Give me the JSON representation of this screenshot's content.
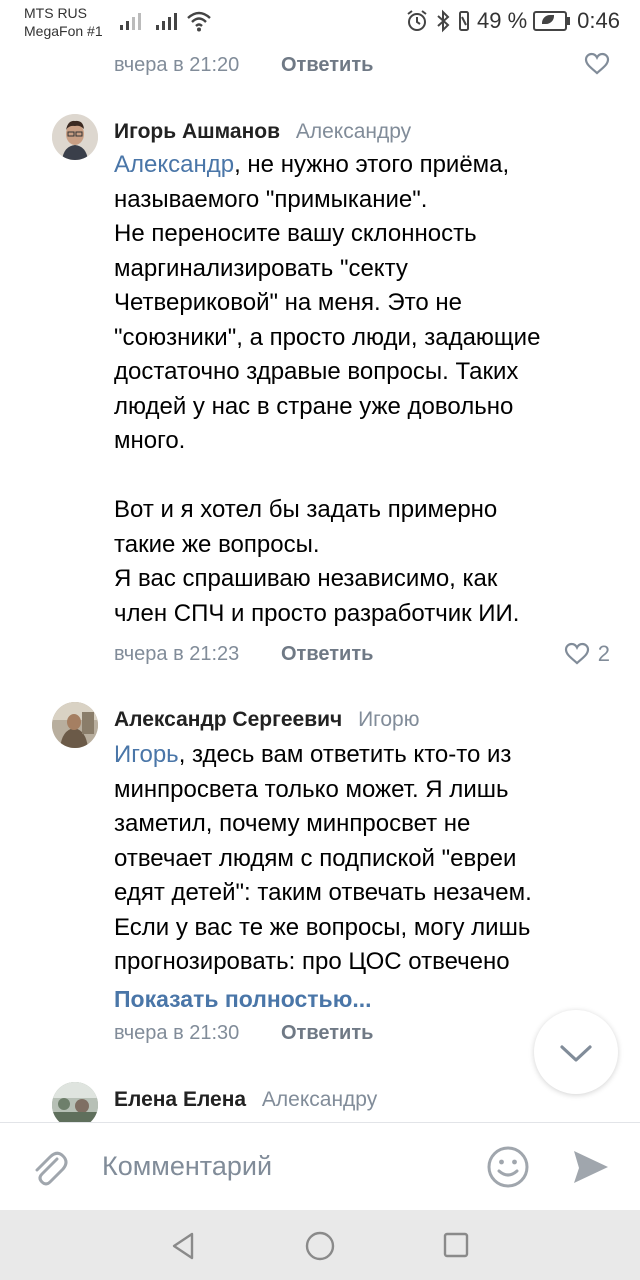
{
  "status_bar": {
    "carrier_1": "MTS RUS",
    "carrier_2": "MegaFon #1",
    "battery_percent": "49 %",
    "time": "0:46"
  },
  "prev_comment": {
    "time": "вчера в 21:20",
    "reply_label": "Ответить"
  },
  "comments": [
    {
      "author": "Игорь Ашманов",
      "reply_to": "Александру",
      "mention": "Александр",
      "text_lines": [
        ", не нужно этого приёма,",
        "называемого \"примыкание\".",
        "Не переносите вашу склонность",
        "маргинализировать \"секту",
        "Четвериковой\" на меня. Это не",
        "\"союзники\", а просто люди, задающие",
        "достаточно здравые вопросы. Таких",
        "людей у нас в стране уже довольно",
        "много.",
        "",
        "Вот и я хотел бы задать примерно",
        "такие же вопросы.",
        "Я вас спрашиваю независимо, как",
        "член СПЧ и просто разработчик ИИ."
      ],
      "time": "вчера в 21:23",
      "reply_label": "Ответить",
      "likes": "2"
    },
    {
      "author": "Александр Сергеевич",
      "reply_to": "Игорю",
      "mention": "Игорь",
      "text_lines": [
        ", здесь вам ответить кто-то из",
        "минпросвета только может. Я лишь",
        "заметил, почему минпросвет не",
        "отвечает людям с подпиской \"евреи",
        "едят детей\": таким отвечать незачем.",
        "Если у вас те же вопросы, могу лишь",
        "прогнозировать: про ЦОС отвечено"
      ],
      "show_more": "Показать полностью...",
      "time": "вчера в 21:30",
      "reply_label": "Ответить"
    },
    {
      "author": "Елена Елена",
      "reply_to": "Александру"
    }
  ],
  "composer": {
    "placeholder": "Комментарий"
  },
  "icons": {
    "attach": "paperclip-icon",
    "emoji": "smile-icon",
    "send": "send-icon",
    "like": "heart-icon",
    "scroll": "chevron-down-icon"
  },
  "colors": {
    "link": "#4a76a8",
    "secondary": "#818c99",
    "icon": "#a0a6ad"
  }
}
